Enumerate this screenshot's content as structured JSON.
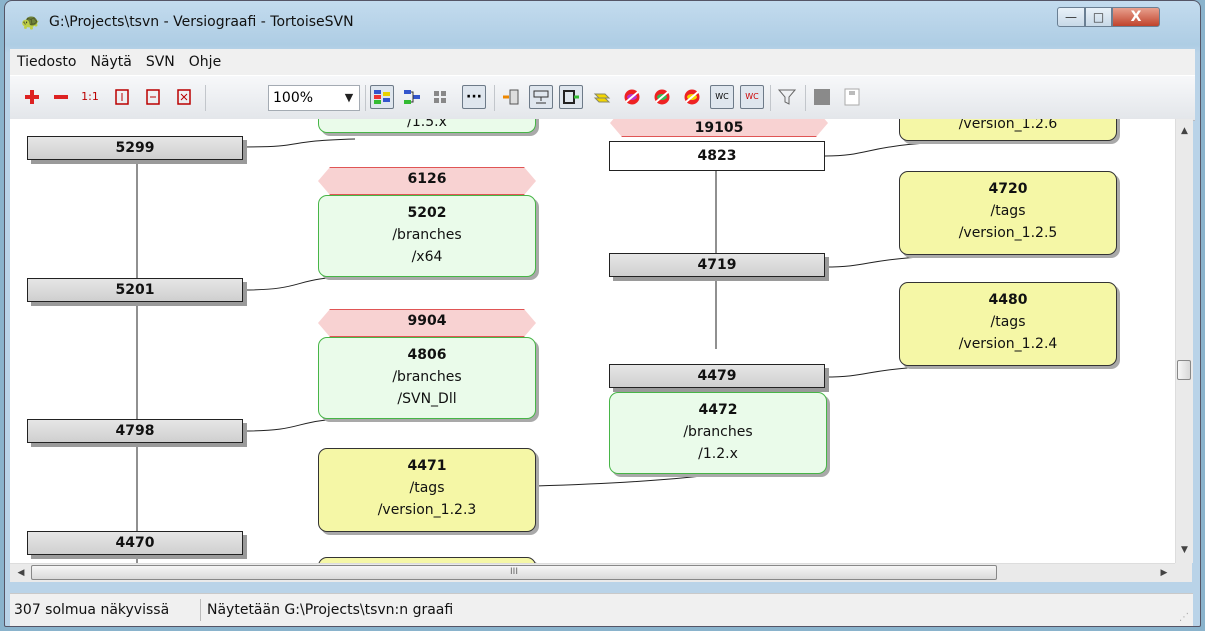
{
  "window": {
    "title": "G:\\Projects\\tsvn - Versiograafi - TortoiseSVN",
    "icon": "tortoise-icon",
    "minimize_glyph": "—",
    "maximize_glyph": "□",
    "close_glyph": "X"
  },
  "menu": [
    "Tiedosto",
    "Näytä",
    "SVN",
    "Ohje"
  ],
  "toolbar": {
    "zoom_in": "zoom-in-icon",
    "zoom_out": "zoom-out-icon",
    "zoom_reset_label": "1:1",
    "zoom_value": "100%",
    "buttons_after_zoom": [
      "group-branches-icon",
      "oldest-on-top-icon",
      "align-trees-icon",
      "reduce-cross-lines-icon",
      "exact-copy-sources-icon",
      "fold-tags-icon",
      "show-trunk-icon",
      "show-tags-icon",
      "remove-deleted-icon",
      "remove-unchanged-icon",
      "remove-unrelated-icon",
      "show-wc-revision-icon",
      "show-wc-modification-icon",
      "filter-icon",
      "tree-stripes-icon",
      "overview-icon"
    ],
    "dots_label": "···",
    "wc_label": "WC"
  },
  "graph": {
    "trunk": [
      "5299",
      "5201",
      "4798",
      "4470"
    ],
    "top_partial_labels": [
      "/1.5.x",
      "19105",
      "/version_1.2.6"
    ],
    "deleted_branches": [
      "6126",
      "9904"
    ],
    "branches": [
      {
        "rev": "5202",
        "path1": "/branches",
        "path2": "/x64"
      },
      {
        "rev": "4806",
        "path1": "/branches",
        "path2": "/SVN_Dll"
      },
      {
        "rev": "4472",
        "path1": "/branches",
        "path2": "/1.2.x"
      }
    ],
    "tags": [
      {
        "rev": "4720",
        "path1": "/tags",
        "path2": "/version_1.2.5"
      },
      {
        "rev": "4480",
        "path1": "/tags",
        "path2": "/version_1.2.4"
      },
      {
        "rev": "4471",
        "path1": "/tags",
        "path2": "/version_1.2.3"
      }
    ],
    "branch_1_2_x_revs": [
      "4823",
      "4719",
      "4479"
    ]
  },
  "status": {
    "nodes_visible": "307 solmua näkyvissä",
    "showing": "Näytetään G:\\Projects\\tsvn:n graafi"
  },
  "scroll": {
    "hscroll_grip": "III"
  }
}
